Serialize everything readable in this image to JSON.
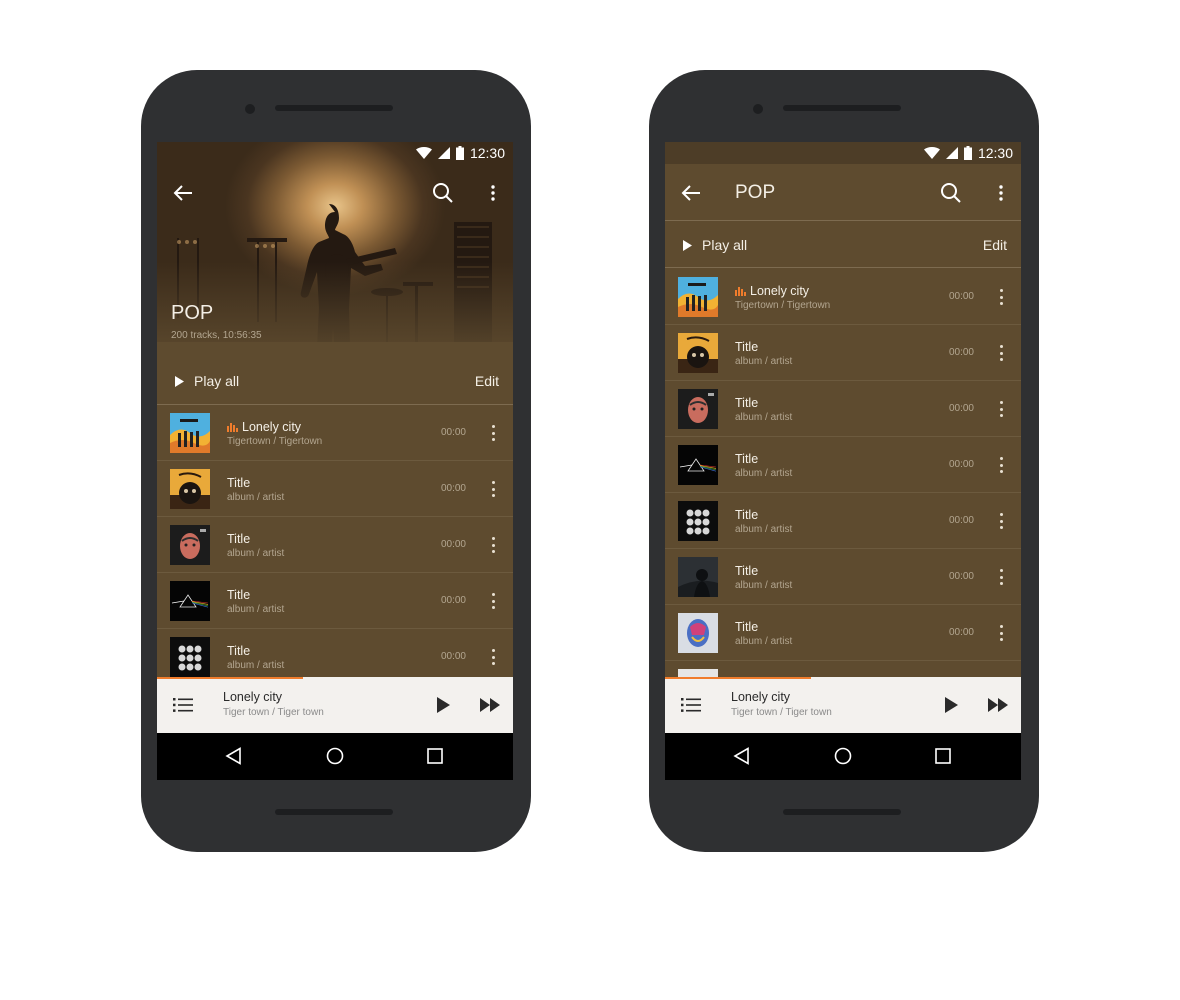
{
  "status": {
    "time": "12:30"
  },
  "screen_left": {
    "title": "POP",
    "subtitle": "200 tracks, 10:56:35",
    "play_all": "Play all",
    "edit": "Edit",
    "tracks": [
      {
        "title": "Lonely city",
        "sub": "Tigertown / Tigertown",
        "duration": "00:00",
        "playing": true
      },
      {
        "title": "Title",
        "sub": "album / artist",
        "duration": "00:00"
      },
      {
        "title": "Title",
        "sub": "album / artist",
        "duration": "00:00"
      },
      {
        "title": "Title",
        "sub": "album / artist",
        "duration": "00:00"
      },
      {
        "title": "Title",
        "sub": "album / artist",
        "duration": "00:00"
      }
    ]
  },
  "screen_right": {
    "title": "POP",
    "play_all": "Play all",
    "edit": "Edit",
    "tracks": [
      {
        "title": "Lonely city",
        "sub": "Tigertown / Tigertown",
        "duration": "00:00",
        "playing": true
      },
      {
        "title": "Title",
        "sub": "album / artist",
        "duration": "00:00"
      },
      {
        "title": "Title",
        "sub": "album / artist",
        "duration": "00:00"
      },
      {
        "title": "Title",
        "sub": "album / artist",
        "duration": "00:00"
      },
      {
        "title": "Title",
        "sub": "album / artist",
        "duration": "00:00"
      },
      {
        "title": "Title",
        "sub": "album / artist",
        "duration": "00:00"
      },
      {
        "title": "Title",
        "sub": "album / artist",
        "duration": "00:00"
      }
    ]
  },
  "mini_player": {
    "title": "Lonely city",
    "sub": "Tiger town / Tiger town",
    "progress": 0.41
  },
  "colors": {
    "background": "#5e4b2f",
    "accent": "#f07c2c",
    "text_primary": "#f4efe6",
    "text_secondary": "#b3a690",
    "mini_player_bg": "#f3f1ee",
    "phone_frame": "#2f3032"
  },
  "icons": {
    "back": "arrow-left-icon",
    "search": "search-icon",
    "more": "more-vert-icon",
    "play": "play-icon",
    "queue": "queue-list-icon",
    "next": "fast-forward-icon",
    "equalizer": "equalizer-icon",
    "nav_back": "nav-back-icon",
    "nav_home": "nav-home-icon",
    "nav_recents": "nav-recents-icon"
  }
}
